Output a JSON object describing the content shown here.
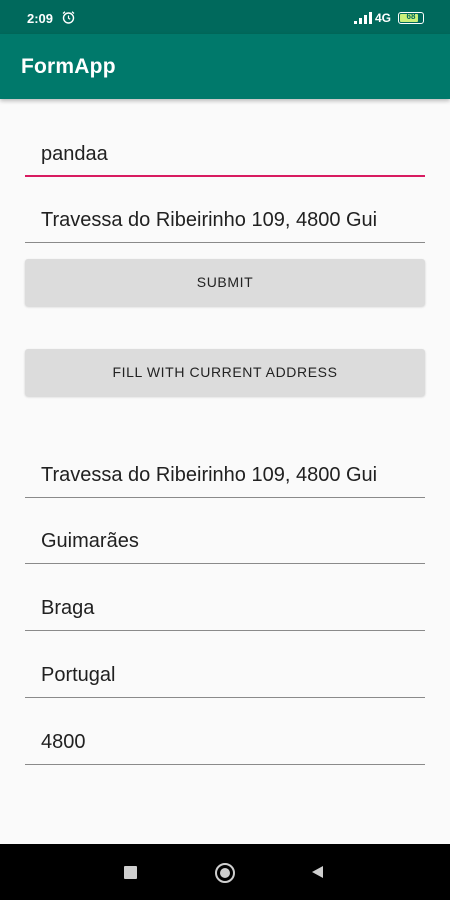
{
  "status_bar": {
    "time": "2:09",
    "network": "4G",
    "battery_level": "68",
    "icons": [
      "alarm-icon",
      "signal-icon",
      "battery-icon"
    ]
  },
  "app_bar": {
    "title": "FormApp"
  },
  "form": {
    "name_value": "pandaa",
    "address_value": "Travessa do Ribeirinho 109, 4800 Gui",
    "submit_label": "SUBMIT",
    "fill_label": "FILL WITH CURRENT ADDRESS"
  },
  "address_details": {
    "street": "Travessa do Ribeirinho 109, 4800 Gui",
    "city": "Guimarães",
    "district": "Braga",
    "country": "Portugal",
    "postal_code": "4800"
  },
  "nav_bar": {
    "icons": [
      "recents-icon",
      "home-icon",
      "back-icon"
    ]
  },
  "colors": {
    "status_bar": "#00695c",
    "app_bar": "#00796b",
    "focus_underline": "#d81b60",
    "button": "#dcdcdc"
  }
}
